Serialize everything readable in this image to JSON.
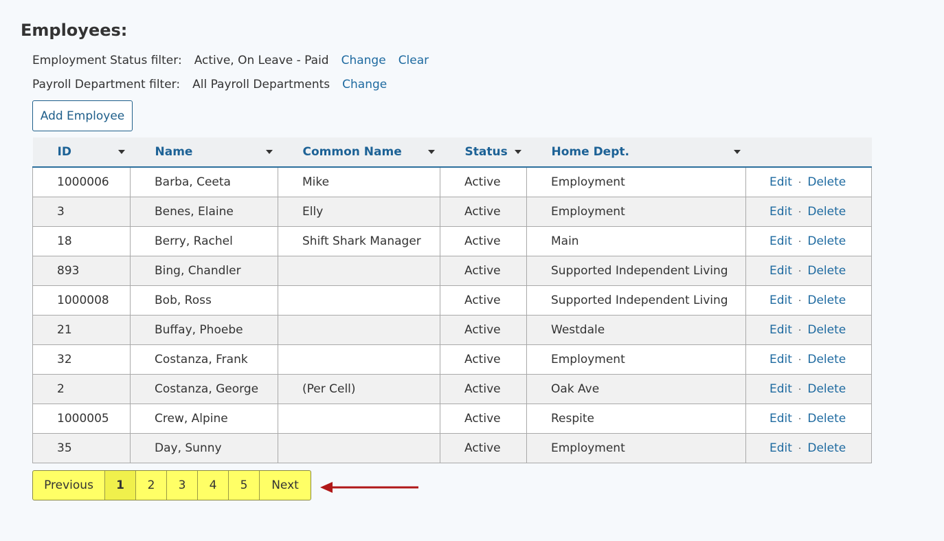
{
  "page": {
    "title": "Employees:"
  },
  "filters": {
    "status": {
      "label": "Employment Status filter:",
      "value": "Active, On Leave - Paid",
      "change": "Change",
      "clear": "Clear"
    },
    "payroll": {
      "label": "Payroll Department filter:",
      "value": "All Payroll Departments",
      "change": "Change"
    }
  },
  "toolbar": {
    "add_employee": "Add Employee"
  },
  "table": {
    "columns": [
      "ID",
      "Name",
      "Common Name",
      "Status",
      "Home Dept."
    ],
    "actions": {
      "edit": "Edit",
      "sep": "·",
      "delete": "Delete"
    },
    "rows": [
      [
        "1000006",
        "Barba, Ceeta",
        "Mike",
        "Active",
        "Employment"
      ],
      [
        "3",
        "Benes, Elaine",
        "Elly",
        "Active",
        "Employment"
      ],
      [
        "18",
        "Berry, Rachel",
        "Shift Shark Manager",
        "Active",
        "Main"
      ],
      [
        "893",
        "Bing, Chandler",
        "",
        "Active",
        "Supported Independent Living"
      ],
      [
        "1000008",
        "Bob, Ross",
        "",
        "Active",
        "Supported Independent Living"
      ],
      [
        "21",
        "Buffay, Phoebe",
        "",
        "Active",
        "Westdale"
      ],
      [
        "32",
        "Costanza, Frank",
        "",
        "Active",
        "Employment"
      ],
      [
        "2",
        "Costanza, George",
        "(Per Cell)",
        "Active",
        "Oak Ave"
      ],
      [
        "1000005",
        "Crew, Alpine",
        "",
        "Active",
        "Respite"
      ],
      [
        "35",
        "Day, Sunny",
        "",
        "Active",
        "Employment"
      ]
    ]
  },
  "pagination": {
    "previous": "Previous",
    "pages": [
      "1",
      "2",
      "3",
      "4",
      "5"
    ],
    "current": "1",
    "next": "Next"
  },
  "colors": {
    "link": "#1e6aa0",
    "pager_bg": "#ffff66",
    "arrow": "#b01818"
  }
}
